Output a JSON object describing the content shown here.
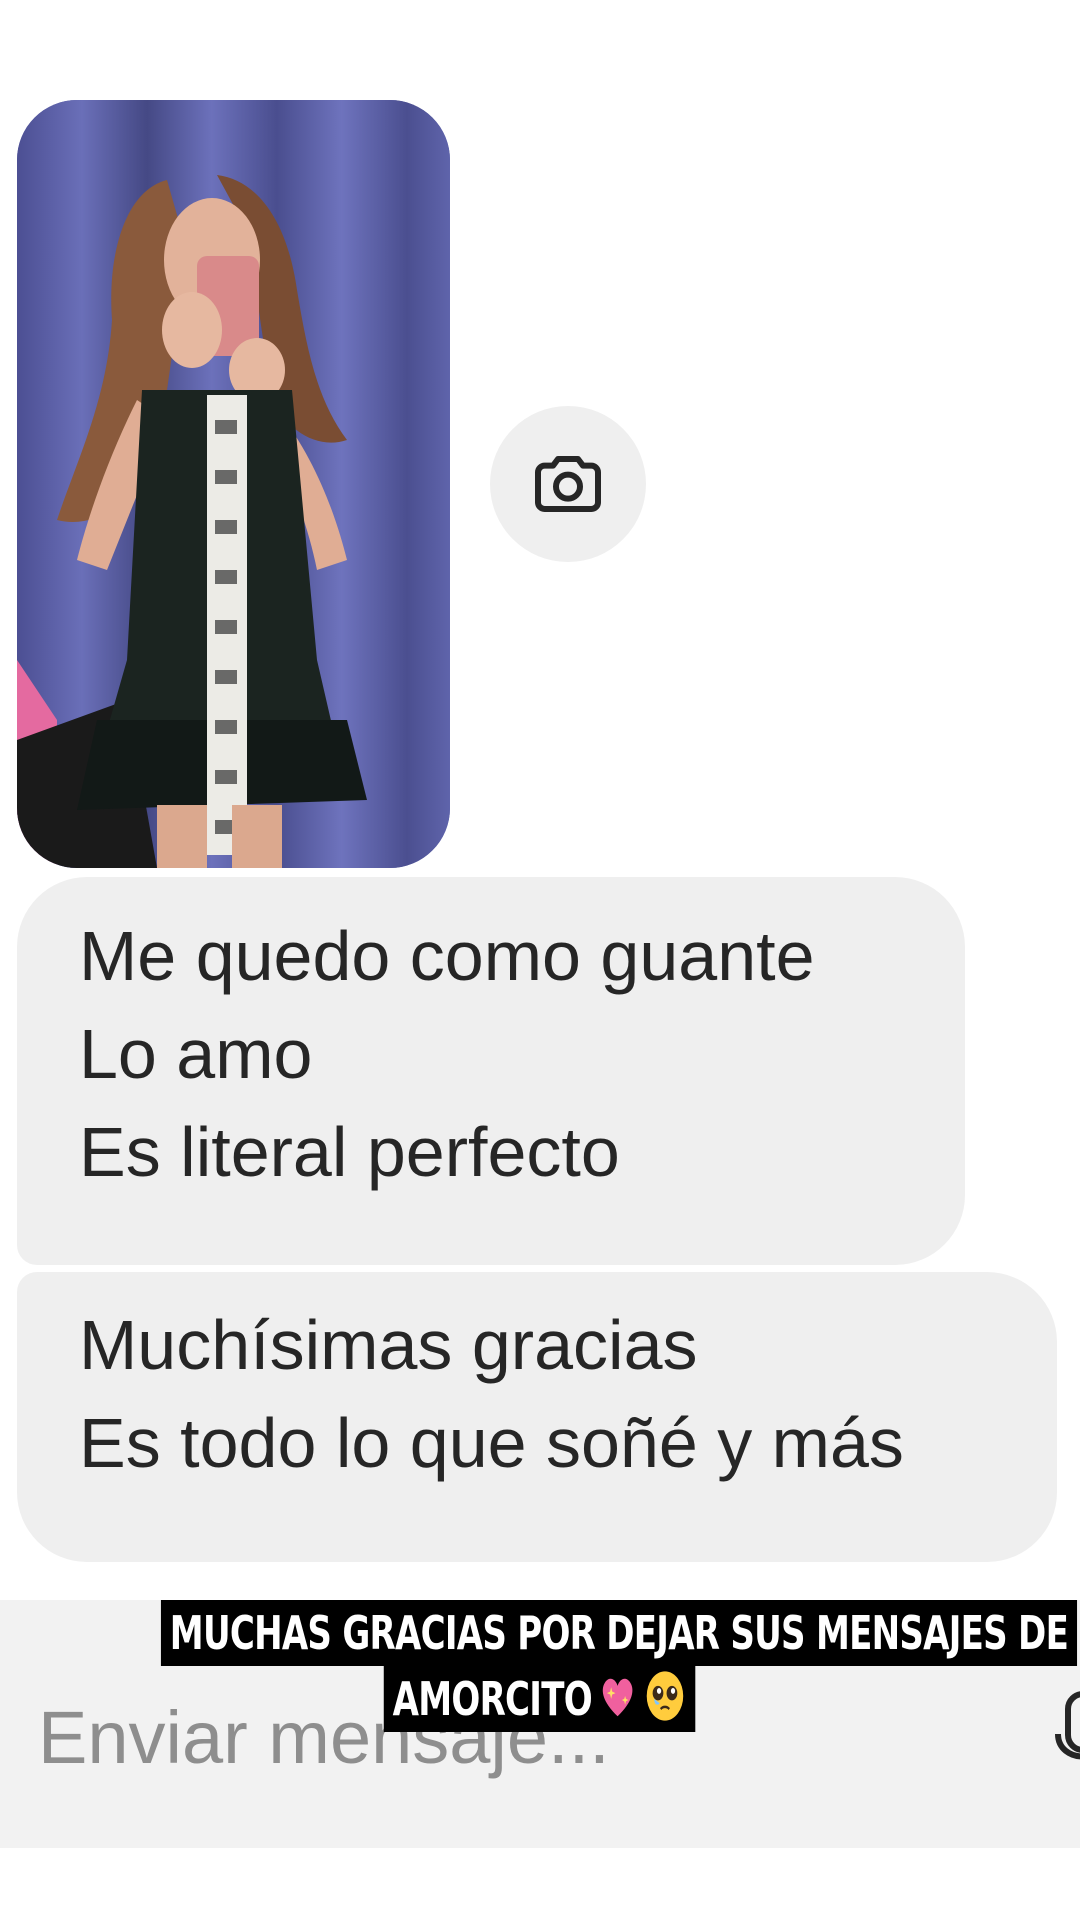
{
  "messages": [
    {
      "lines": [
        "Me quedo como guante",
        "Lo amo",
        "Es literal perfecto"
      ]
    },
    {
      "lines": [
        "Muchísimas gracias",
        "Es todo lo que soñé y más"
      ]
    }
  ],
  "composer": {
    "placeholder": "Enviar mensaje..."
  },
  "caption": {
    "line1": "MUCHAS GRACIAS POR DEJAR SUS MENSAJES DE",
    "line2": "AMORCITO"
  },
  "icons": {
    "camera": "camera-icon",
    "mic": "microphone-icon",
    "emoji1": "sparkling-heart-emoji",
    "emoji2": "pleading-face-emoji"
  },
  "colors": {
    "bubble": "#efefef",
    "text": "#262626",
    "placeholder": "#8e8e8e",
    "caption_bg": "#000000",
    "caption_text": "#ffffff"
  }
}
